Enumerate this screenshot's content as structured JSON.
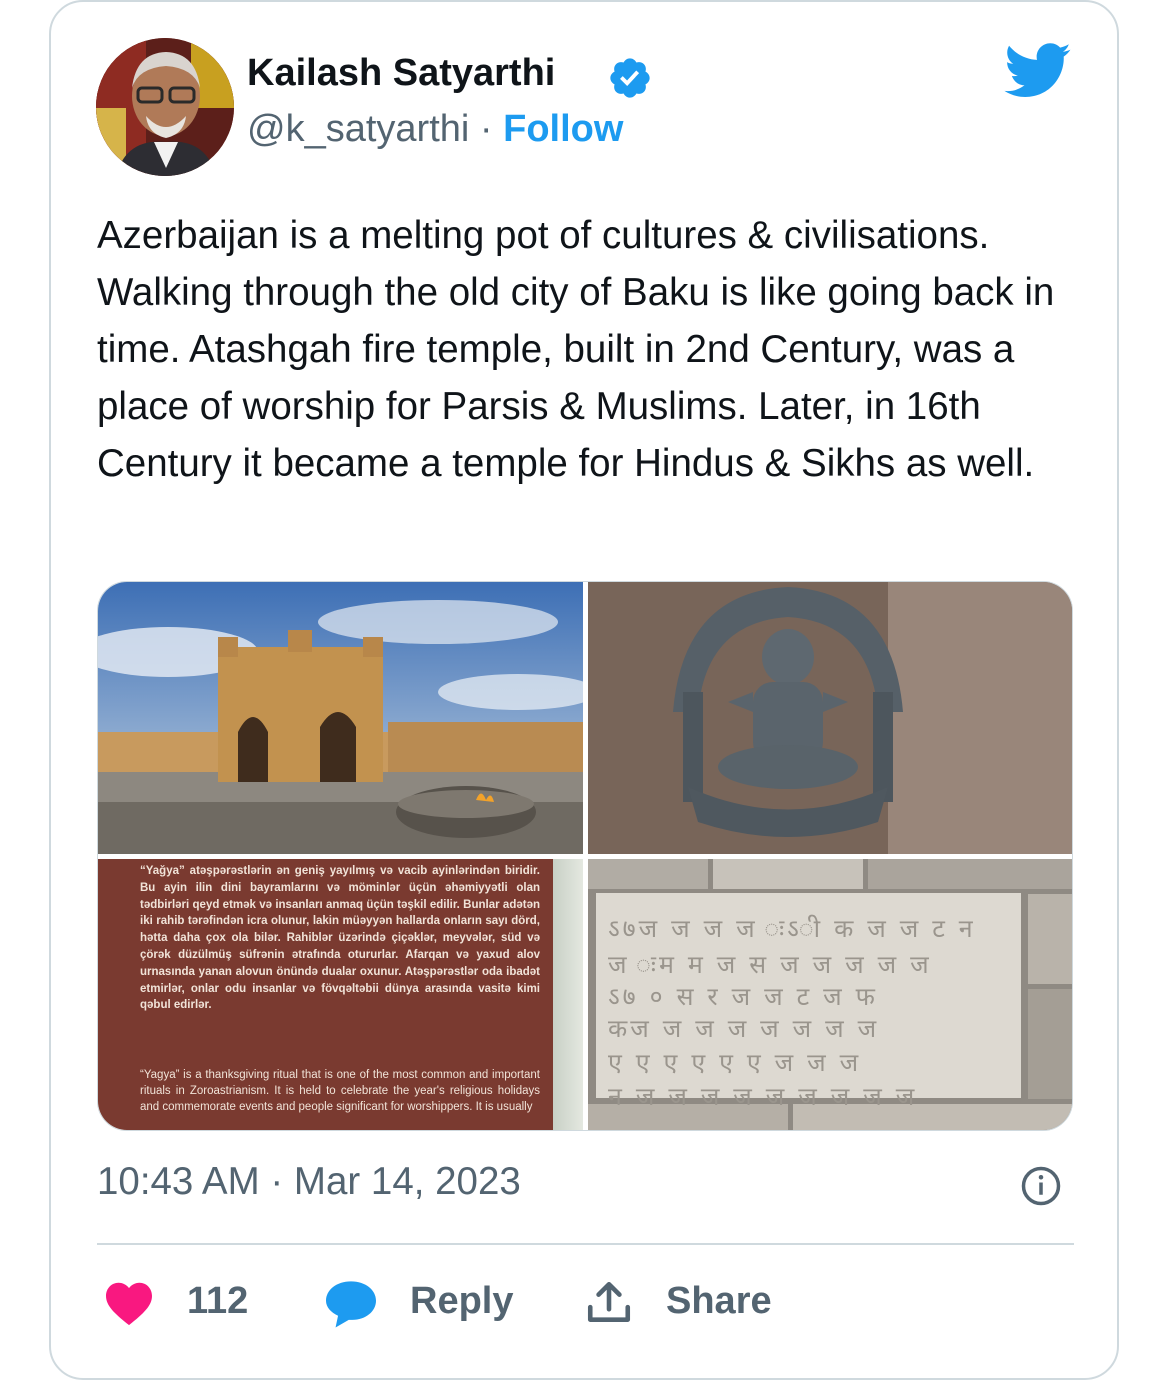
{
  "author": {
    "name": "Kailash Satyarthi",
    "handle": "@k_satyarthi",
    "separator": "·",
    "follow_label": "Follow"
  },
  "icons": {
    "verified": "verified-badge-icon",
    "logo": "twitter-bird-icon",
    "info": "info-icon",
    "like": "heart-icon",
    "reply": "speech-bubble-icon",
    "share": "share-upload-icon"
  },
  "colors": {
    "accent": "#1d9bf0",
    "like": "#f91880",
    "muted": "#536471",
    "text": "#0f1419"
  },
  "tweet": {
    "text": "Azerbaijan is a melting pot of cultures & civilisations. Walking through the old city of Baku is like going back in time. Atashgah fire temple, built in 2nd Century, was a place of worship for Parsis & Muslims. Later, in 16th Century it became a temple for Hindus & Sikhs as well."
  },
  "media": {
    "sign_text_az": "“Yağya” atəşpərəstlərin ən geniş yayılmış və vacib ayinlərindən biridir. Bu ayin ilin dini bayramlarını və möminlər üçün əhəmiyyətli olan tədbirləri qeyd etmək və insanları anmaq üçün təşkil edilir. Bunlar adətən iki rahib tərəfindən icra olunur, lakin müəyyən hallarda onların sayı dörd, hətta daha çox ola bilər. Rahiblər üzərində çiçəklər, meyvələr, süd və çörək düzülmüş süfrənin ətrafında otururlar. Afarqan və yaxud alov urnasında yanan alovun önündə dualar oxunur. Atəşpərəstlər oda ibadət etmirlər, onlar odu insanlar və fövqəltəbii dünya arasında vasitə kimi qəbul edirlər.",
    "sign_text_en": "“Yagya” is a thanksgiving ritual that is one of the most common and important rituals in Zoroastrianism. It is held to celebrate the year's religious holidays and commemorate events and people significant for worshippers. It is usually"
  },
  "timestamp": {
    "time": "10:43 AM",
    "separator": "·",
    "date": "Mar 14, 2023"
  },
  "actions": {
    "like_count": "112",
    "reply_label": "Reply",
    "share_label": "Share"
  }
}
